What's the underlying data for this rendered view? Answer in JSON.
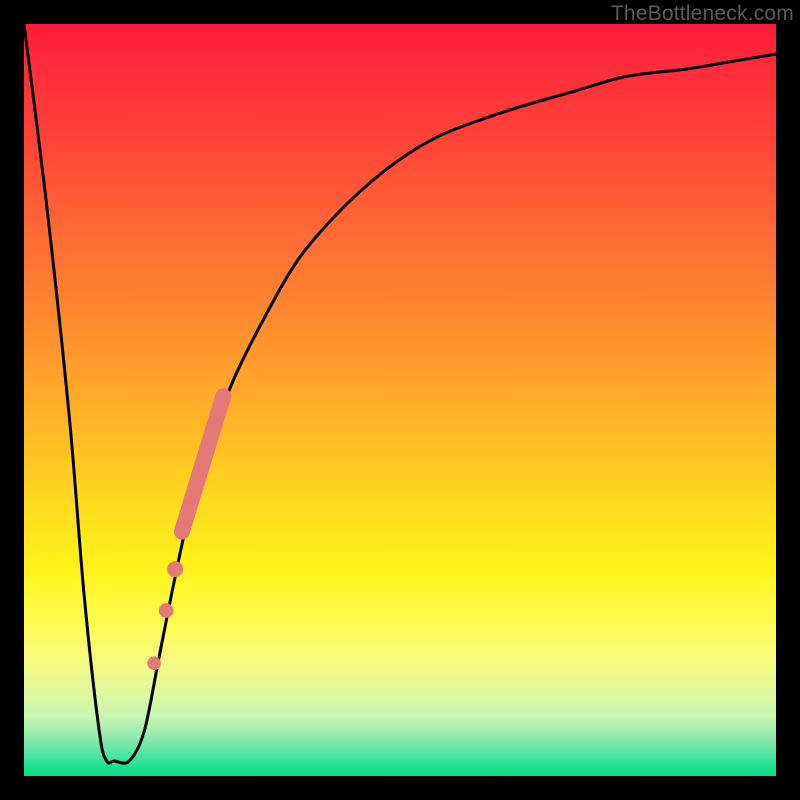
{
  "watermark": "TheBottleneck.com",
  "colors": {
    "frame": "#000000",
    "curve": "#000000",
    "marker_fill": "#e47a78",
    "marker_stroke": "#d86a67"
  },
  "chart_data": {
    "type": "line",
    "title": "",
    "xlabel": "",
    "ylabel": "",
    "xlim": [
      0,
      100
    ],
    "ylim": [
      0,
      100
    ],
    "grid": false,
    "legend": false,
    "series": [
      {
        "name": "bottleneck-curve",
        "x": [
          0,
          3,
          6,
          8,
          10,
          11,
          12,
          14,
          16,
          18,
          20,
          22,
          25,
          28,
          32,
          36,
          40,
          45,
          50,
          55,
          60,
          66,
          73,
          80,
          88,
          94,
          100
        ],
        "y": [
          100,
          76,
          48,
          24,
          6,
          2,
          2,
          2,
          6,
          16,
          26,
          35,
          45,
          53,
          61,
          68,
          73,
          78,
          82,
          85,
          87,
          89,
          91,
          93,
          94,
          95,
          96
        ]
      }
    ],
    "markers": {
      "segment": {
        "x0": 21.0,
        "y0": 32.5,
        "x1": 26.5,
        "y1": 50.5
      },
      "dots": [
        {
          "x": 20.1,
          "y": 27.5
        },
        {
          "x": 18.9,
          "y": 22.0
        },
        {
          "x": 17.3,
          "y": 15.0
        }
      ]
    },
    "annotations": []
  }
}
